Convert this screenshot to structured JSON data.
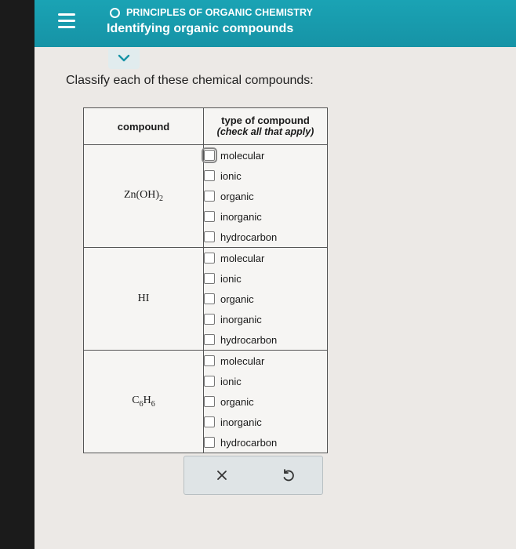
{
  "header": {
    "topic": "PRINCIPLES OF ORGANIC CHEMISTRY",
    "title": "Identifying organic compounds",
    "accent_color": "#1693a6"
  },
  "prompt": "Classify each of these chemical compounds:",
  "table": {
    "header_compound": "compound",
    "header_type": "type of compound",
    "header_type_sub": "(check all that apply)",
    "rows": [
      {
        "compound_main": "Zn(OH)",
        "compound_sub": "2",
        "options": [
          "molecular",
          "ionic",
          "organic",
          "inorganic",
          "hydrocarbon"
        ]
      },
      {
        "compound": "HI",
        "options": [
          "molecular",
          "ionic",
          "organic",
          "inorganic",
          "hydrocarbon"
        ]
      },
      {
        "compound_c": "C",
        "compound_c_sub": "6",
        "compound_h": "H",
        "compound_h_sub": "6",
        "options": [
          "molecular",
          "ionic",
          "organic",
          "inorganic",
          "hydrocarbon"
        ]
      }
    ]
  },
  "icons": {
    "menu": "menu-icon",
    "chevron": "chevron-down-icon",
    "clear": "close-icon",
    "undo": "undo-icon"
  }
}
